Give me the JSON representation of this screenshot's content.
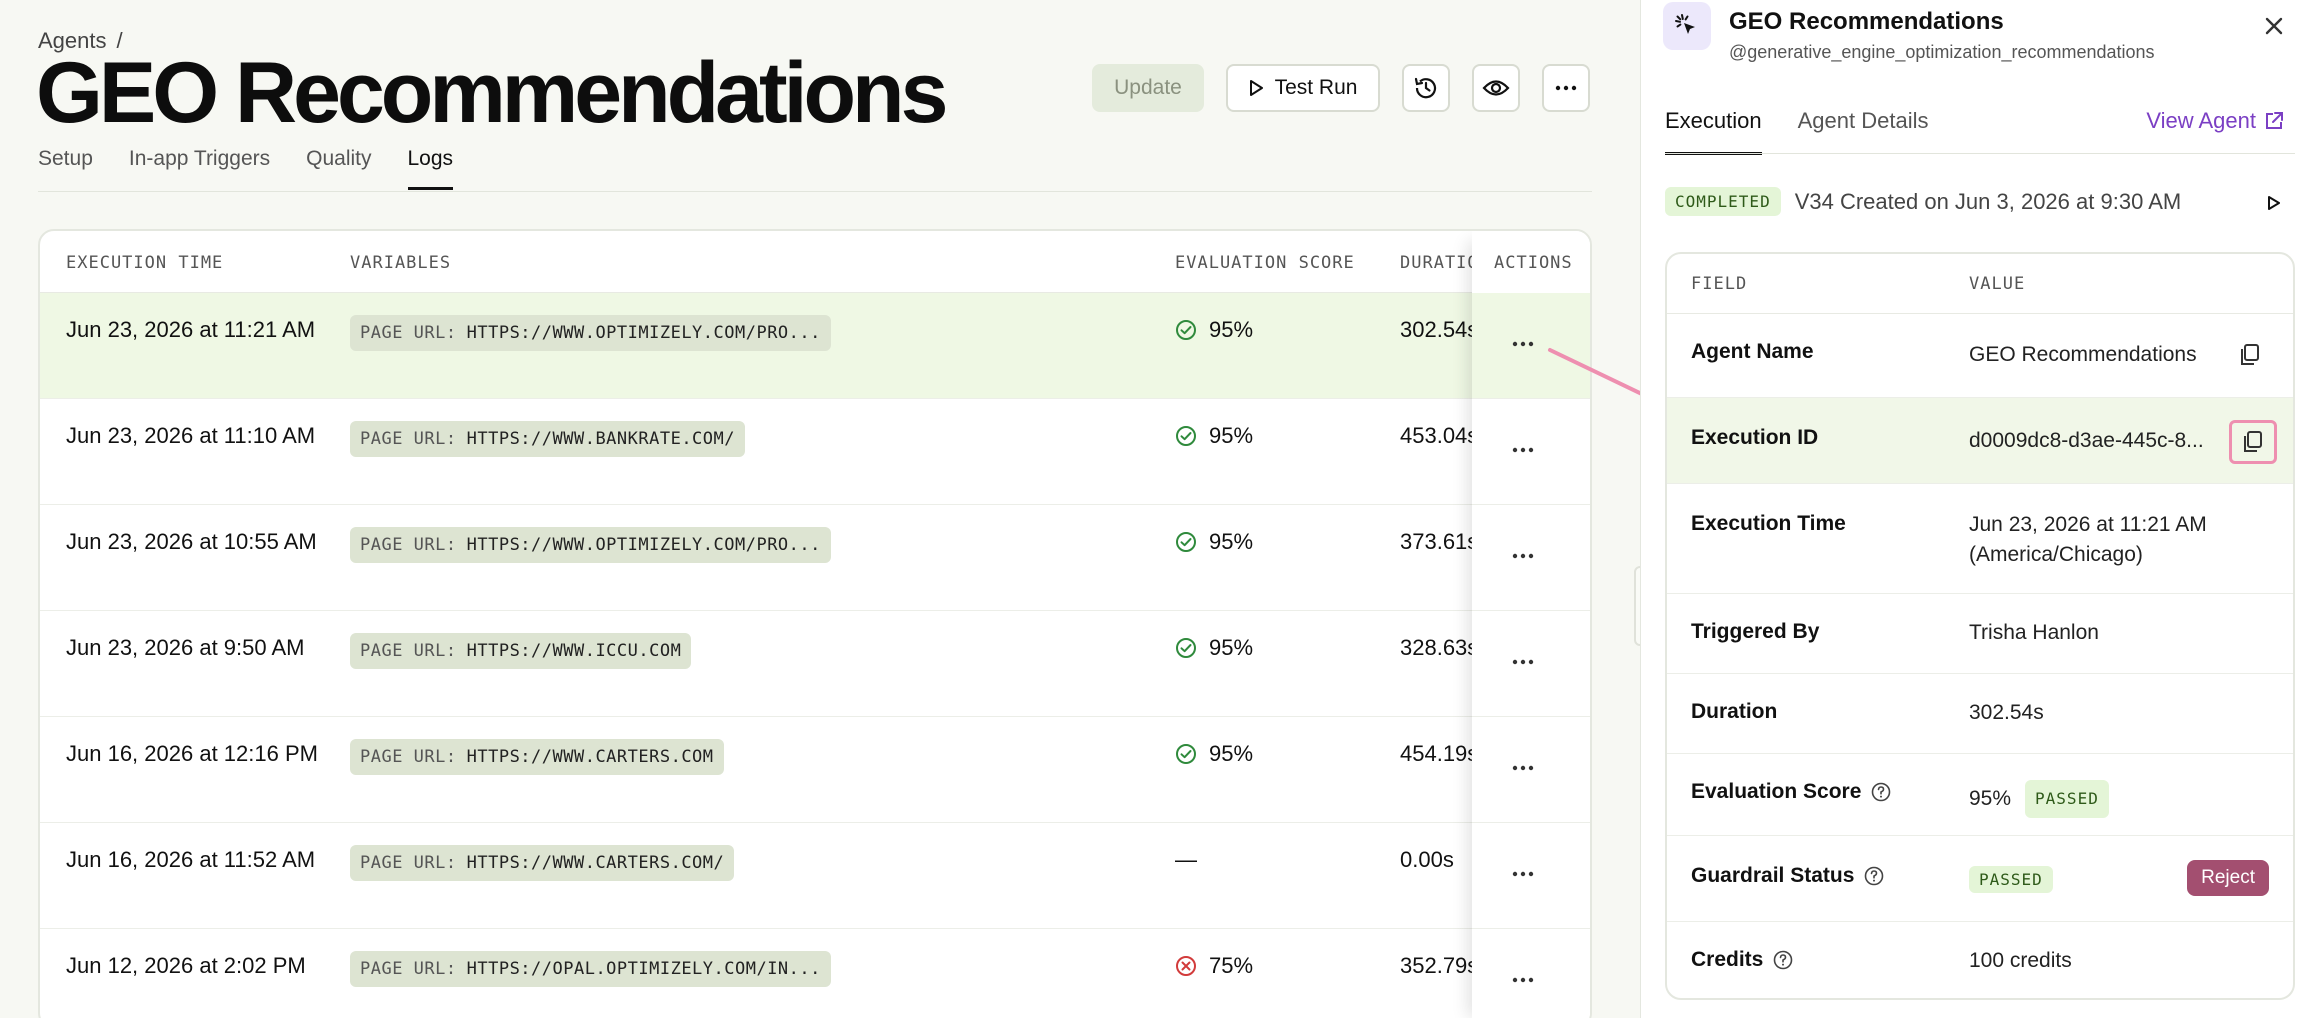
{
  "breadcrumb": {
    "parent": "Agents",
    "separator": "/"
  },
  "page": {
    "title": "GEO Recommendations"
  },
  "header_actions": {
    "update_label": "Update",
    "test_run_label": "Test Run",
    "history_icon": "history-icon",
    "preview_icon": "eye-icon",
    "more_icon": "more-horizontal-icon"
  },
  "tabs": [
    {
      "label": "Setup",
      "active": false
    },
    {
      "label": "In-app Triggers",
      "active": false
    },
    {
      "label": "Quality",
      "active": false
    },
    {
      "label": "Logs",
      "active": true
    }
  ],
  "logs_table": {
    "headers": {
      "execution_time": "EXECUTION TIME",
      "variables": "VARIABLES",
      "evaluation_score": "EVALUATION SCORE",
      "duration": "DURATION",
      "actions": "ACTIONS"
    },
    "rows": [
      {
        "time": "Jun 23, 2026 at 11:21 AM",
        "var_key": "PAGE URL:",
        "var_value": "HTTPS://WWW.OPTIMIZELY.COM/PRO...",
        "score": "95%",
        "status": "pass",
        "duration": "302.54s",
        "highlight": true
      },
      {
        "time": "Jun 23, 2026 at 11:10 AM",
        "var_key": "PAGE URL:",
        "var_value": "HTTPS://WWW.BANKRATE.COM/",
        "score": "95%",
        "status": "pass",
        "duration": "453.04s",
        "highlight": false
      },
      {
        "time": "Jun 23, 2026 at 10:55 AM",
        "var_key": "PAGE URL:",
        "var_value": "HTTPS://WWW.OPTIMIZELY.COM/PRO...",
        "score": "95%",
        "status": "pass",
        "duration": "373.61s",
        "highlight": false
      },
      {
        "time": "Jun 23, 2026 at 9:50 AM",
        "var_key": "PAGE URL:",
        "var_value": "HTTPS://WWW.ICCU.COM",
        "score": "95%",
        "status": "pass",
        "duration": "328.63s",
        "highlight": false
      },
      {
        "time": "Jun 16, 2026 at 12:16 PM",
        "var_key": "PAGE URL:",
        "var_value": "HTTPS://WWW.CARTERS.COM",
        "score": "95%",
        "status": "pass",
        "duration": "454.19s",
        "highlight": false
      },
      {
        "time": "Jun 16, 2026 at 11:52 AM",
        "var_key": "PAGE URL:",
        "var_value": "HTTPS://WWW.CARTERS.COM/",
        "score": "—",
        "status": "none",
        "duration": "0.00s",
        "highlight": false
      },
      {
        "time": "Jun 12, 2026 at 2:02 PM",
        "var_key": "PAGE URL:",
        "var_value": "HTTPS://OPAL.OPTIMIZELY.COM/IN...",
        "score": "75%",
        "status": "fail",
        "duration": "352.79s",
        "highlight": false
      }
    ]
  },
  "panel": {
    "agent_name": "GEO Recommendations",
    "agent_handle": "@generative_engine_optimization_recommendations",
    "tabs": [
      {
        "label": "Execution",
        "active": true
      },
      {
        "label": "Agent Details",
        "active": false
      }
    ],
    "view_agent_label": "View Agent",
    "status_badge": "COMPLETED",
    "status_text": "V34 Created on Jun 3, 2026 at 9:30 AM",
    "fields_header": {
      "field": "FIELD",
      "value": "VALUE"
    },
    "fields": {
      "agent_name": {
        "label": "Agent Name",
        "value": "GEO Recommendations"
      },
      "execution_id": {
        "label": "Execution ID",
        "value": "d0009dc8-d3ae-445c-8..."
      },
      "execution_time": {
        "label": "Execution Time",
        "value": "Jun 23, 2026 at 11:21 AM",
        "value2": "(America/Chicago)"
      },
      "triggered_by": {
        "label": "Triggered By",
        "value": "Trisha Hanlon"
      },
      "duration": {
        "label": "Duration",
        "value": "302.54s"
      },
      "evaluation_score": {
        "label": "Evaluation Score",
        "value": "95%",
        "badge": "PASSED"
      },
      "guardrail_status": {
        "label": "Guardrail Status",
        "badge": "PASSED",
        "reject_label": "Reject"
      },
      "credits": {
        "label": "Credits",
        "value": "100 credits"
      }
    }
  },
  "colors": {
    "accent_purple": "#7b3fc4",
    "pass_green": "#2f8a3c",
    "fail_red": "#d23b3b",
    "highlight_row": "#eff8e4",
    "reject": "#a34f70",
    "annotation_pink": "#ee8fb0"
  }
}
